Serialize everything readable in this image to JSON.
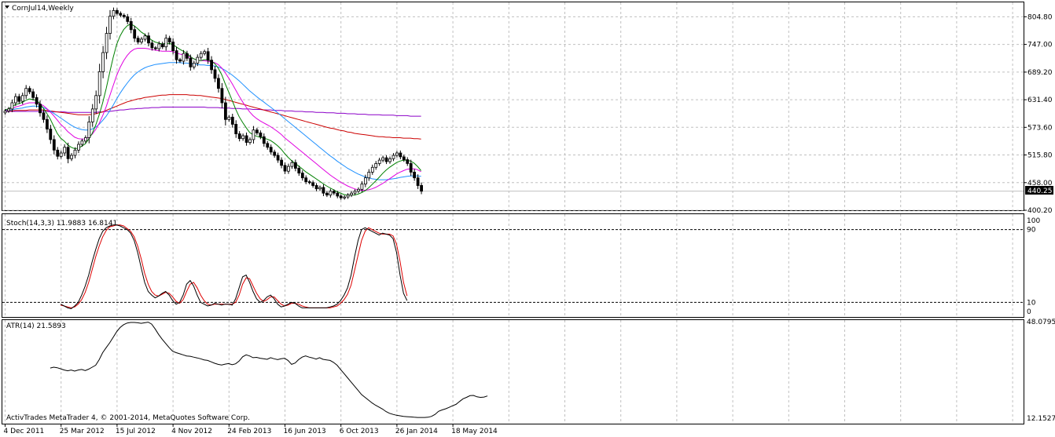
{
  "window": {
    "title": "CornJul14,Weekly",
    "copyright": "ActivTrades MetaTrader 4, © 2001-2014, MetaQuotes Software Corp."
  },
  "colors": {
    "grid": "#c0c0c0",
    "bull_candle": "#ffffff",
    "bear_candle": "#000000",
    "ma_fast": "#008000",
    "ma_magenta": "#e000e0",
    "ma_blue": "#1e90ff",
    "ma_red": "#cc0000",
    "ma_purple": "#8b00c8",
    "stoch_main": "#000000",
    "stoch_signal": "#dd0000",
    "atr": "#000000"
  },
  "chart_data": [
    {
      "type": "candlestick",
      "title": "CornJul14,Weekly",
      "ylim": [
        400.2,
        835.0
      ],
      "yticks": [
        804.8,
        747.0,
        689.2,
        631.4,
        573.6,
        515.8,
        458.0,
        400.2
      ],
      "ytick_labels": [
        "804.80",
        "747.00",
        "689.20",
        "631.40",
        "573.60",
        "515.80",
        "458.00",
        "400.20"
      ],
      "current_price_label": "440.25",
      "current_price": 440.25,
      "x_labels": [
        "4 Dec 2011",
        "25 Mar 2012",
        "15 Jul 2012",
        "4 Nov 2012",
        "24 Feb 2013",
        "16 Jun 2013",
        "6 Oct 2013",
        "26 Jan 2014",
        "18 May 2014"
      ],
      "close": [
        608,
        612,
        625,
        638,
        628,
        640,
        655,
        648,
        636,
        622,
        604,
        590,
        570,
        548,
        526,
        513,
        520,
        532,
        508,
        515,
        526,
        538,
        545,
        552,
        585,
        612,
        640,
        690,
        730,
        770,
        806,
        818,
        812,
        808,
        805,
        795,
        778,
        760,
        752,
        758,
        765,
        750,
        740,
        738,
        748,
        742,
        760,
        752,
        734,
        715,
        712,
        728,
        718,
        700,
        708,
        720,
        728,
        732,
        714,
        694,
        676,
        655,
        625,
        590,
        595,
        580,
        560,
        550,
        556,
        542,
        548,
        568,
        562,
        554,
        540,
        532,
        522,
        515,
        505,
        494,
        482,
        492,
        500,
        488,
        478,
        468,
        460,
        458,
        452,
        445,
        448,
        436,
        432,
        440,
        436,
        430,
        426,
        428,
        432,
        436,
        440,
        444,
        455,
        468,
        480,
        490,
        498,
        505,
        510,
        502,
        508,
        515,
        520,
        512,
        506,
        498,
        480,
        468,
        452,
        440
      ],
      "ma_fast": [
        610,
        612,
        616,
        621,
        623,
        626,
        630,
        633,
        632,
        630,
        624,
        614,
        603,
        591,
        576,
        561,
        551,
        545,
        537,
        532,
        529,
        530,
        534,
        539,
        549,
        561,
        578,
        600,
        625,
        655,
        688,
        720,
        747,
        765,
        778,
        786,
        790,
        786,
        780,
        773,
        768,
        762,
        756,
        752,
        750,
        748,
        749,
        749,
        747,
        742,
        737,
        733,
        729,
        722,
        717,
        714,
        713,
        715,
        715,
        712,
        707,
        698,
        684,
        665,
        648,
        630,
        612,
        596,
        584,
        573,
        563,
        558,
        555,
        553,
        551,
        549,
        546,
        541,
        535,
        528,
        519,
        511,
        504,
        498,
        493,
        487,
        481,
        476,
        471,
        466,
        461,
        456,
        451,
        447,
        443,
        439,
        436,
        433,
        432,
        432,
        432,
        434,
        437,
        441,
        447,
        454,
        461,
        469,
        477,
        484,
        490,
        495,
        500,
        503,
        505,
        505,
        503,
        499,
        492,
        483
      ],
      "ma_magenta": [
        609,
        611,
        613,
        616,
        618,
        620,
        623,
        625,
        625,
        625,
        623,
        619,
        613,
        606,
        598,
        589,
        580,
        573,
        565,
        559,
        553,
        550,
        549,
        549,
        553,
        559,
        569,
        582,
        598,
        617,
        639,
        661,
        682,
        699,
        713,
        724,
        732,
        737,
        739,
        739,
        739,
        738,
        736,
        735,
        734,
        733,
        733,
        733,
        732,
        730,
        727,
        725,
        723,
        720,
        717,
        714,
        713,
        713,
        712,
        711,
        709,
        705,
        698,
        688,
        677,
        665,
        652,
        639,
        627,
        616,
        606,
        598,
        592,
        587,
        583,
        579,
        575,
        570,
        565,
        559,
        552,
        546,
        540,
        534,
        528,
        522,
        516,
        510,
        504,
        498,
        492,
        486,
        480,
        474,
        469,
        464,
        459,
        455,
        451,
        448,
        445,
        443,
        442,
        442,
        443,
        445,
        448,
        452,
        456,
        461,
        466,
        471,
        476,
        480,
        483,
        486,
        487,
        487,
        485,
        481
      ],
      "ma_blue": [
        608,
        609,
        610,
        612,
        613,
        614,
        616,
        617,
        618,
        618,
        617,
        615,
        612,
        608,
        603,
        598,
        593,
        588,
        583,
        578,
        574,
        571,
        569,
        568,
        568,
        570,
        574,
        580,
        588,
        597,
        608,
        620,
        633,
        645,
        656,
        666,
        675,
        683,
        689,
        694,
        698,
        701,
        703,
        705,
        706,
        707,
        708,
        709,
        709,
        709,
        709,
        708,
        708,
        707,
        706,
        705,
        704,
        704,
        703,
        703,
        702,
        700,
        697,
        693,
        688,
        683,
        677,
        671,
        664,
        657,
        650,
        644,
        638,
        632,
        627,
        621,
        616,
        610,
        604,
        598,
        592,
        586,
        580,
        574,
        568,
        562,
        556,
        550,
        544,
        538,
        532,
        526,
        520,
        514,
        509,
        503,
        498,
        493,
        488,
        484,
        480,
        476,
        473,
        470,
        468,
        466,
        465,
        464,
        464,
        464,
        465,
        466,
        467,
        469,
        470,
        471,
        472,
        472,
        472,
        471
      ],
      "ma_red": [
        608,
        608,
        608,
        609,
        609,
        609,
        609,
        610,
        610,
        610,
        610,
        610,
        609,
        608,
        607,
        606,
        605,
        604,
        603,
        602,
        601,
        600,
        600,
        600,
        600,
        601,
        602,
        604,
        606,
        609,
        612,
        615,
        618,
        621,
        624,
        627,
        629,
        631,
        633,
        634,
        636,
        637,
        638,
        639,
        640,
        641,
        641,
        642,
        642,
        642,
        642,
        642,
        642,
        641,
        641,
        640,
        640,
        639,
        638,
        637,
        636,
        635,
        634,
        632,
        630,
        628,
        626,
        624,
        622,
        620,
        618,
        616,
        614,
        612,
        610,
        608,
        606,
        604,
        602,
        600,
        598,
        596,
        594,
        592,
        590,
        588,
        586,
        584,
        582,
        580,
        578,
        576,
        574,
        572,
        571,
        569,
        567,
        566,
        564,
        563,
        561,
        560,
        559,
        558,
        557,
        556,
        555,
        554,
        554,
        553,
        553,
        552,
        552,
        552,
        551,
        551,
        551,
        550,
        550,
        549
      ],
      "ma_purple": [
        607,
        607,
        607,
        607,
        607,
        607,
        607,
        607,
        607,
        607,
        607,
        607,
        607,
        606,
        606,
        606,
        606,
        606,
        605,
        605,
        605,
        605,
        605,
        605,
        605,
        605,
        605,
        606,
        606,
        607,
        607,
        608,
        609,
        610,
        610,
        611,
        612,
        612,
        613,
        613,
        614,
        614,
        615,
        615,
        615,
        616,
        616,
        616,
        616,
        616,
        616,
        616,
        616,
        616,
        616,
        616,
        616,
        616,
        615,
        615,
        615,
        615,
        614,
        614,
        614,
        613,
        613,
        613,
        612,
        612,
        612,
        611,
        611,
        611,
        610,
        610,
        610,
        609,
        609,
        609,
        608,
        608,
        608,
        607,
        607,
        607,
        606,
        606,
        606,
        605,
        605,
        605,
        604,
        604,
        604,
        603,
        603,
        603,
        602,
        602,
        602,
        601,
        601,
        601,
        600,
        600,
        600,
        600,
        599,
        599,
        599,
        599,
        598,
        598,
        598,
        598,
        597,
        597,
        597,
        597
      ]
    },
    {
      "type": "line",
      "title": "Stoch(14,3,3) 11.9883 16.8141",
      "ylim": [
        0,
        100
      ],
      "levels": [
        90,
        10
      ],
      "ytick_labels": [
        "100",
        "90",
        "10",
        "0"
      ],
      "start_index": 16,
      "series": [
        {
          "name": "main",
          "values": [
            8,
            6,
            4,
            3,
            6,
            10,
            18,
            28,
            40,
            55,
            68,
            80,
            88,
            92,
            94,
            95,
            95,
            94,
            92,
            90,
            86,
            78,
            65,
            48,
            32,
            22,
            18,
            15,
            17,
            20,
            22,
            18,
            12,
            8,
            10,
            18,
            30,
            34,
            28,
            18,
            10,
            8,
            6,
            7,
            9,
            8,
            7,
            8,
            8,
            7,
            14,
            26,
            38,
            40,
            32,
            22,
            14,
            10,
            12,
            16,
            18,
            14,
            8,
            5,
            6,
            8,
            10,
            9,
            6,
            4,
            4,
            4,
            4,
            4,
            4,
            4,
            4,
            5,
            6,
            8,
            12,
            18,
            26,
            40,
            60,
            78,
            90,
            92,
            90,
            88,
            86,
            84,
            86,
            85,
            84,
            80,
            65,
            40,
            20,
            12
          ]
        },
        {
          "name": "signal",
          "values": [
            7,
            6,
            5,
            4,
            5,
            8,
            13,
            21,
            32,
            46,
            60,
            72,
            82,
            89,
            93,
            94,
            95,
            95,
            94,
            91,
            88,
            82,
            72,
            58,
            42,
            30,
            22,
            18,
            17,
            19,
            21,
            20,
            16,
            11,
            9,
            13,
            22,
            30,
            32,
            26,
            18,
            12,
            8,
            7,
            8,
            8,
            8,
            8,
            8,
            8,
            10,
            18,
            30,
            37,
            36,
            28,
            20,
            14,
            11,
            13,
            16,
            16,
            12,
            8,
            6,
            7,
            9,
            9,
            8,
            6,
            5,
            4,
            4,
            4,
            4,
            4,
            4,
            4,
            5,
            6,
            9,
            13,
            19,
            29,
            45,
            62,
            78,
            88,
            92,
            90,
            88,
            86,
            85,
            85,
            85,
            83,
            74,
            55,
            32,
            17
          ]
        }
      ]
    },
    {
      "type": "line",
      "title": "ATR(14) 21.5893",
      "ylim": [
        12.1527,
        48.0795
      ],
      "ytick_labels": [
        "48.0795",
        "12.1527"
      ],
      "start_index": 13,
      "series": [
        {
          "name": "ATR(14)",
          "values": [
            31.5,
            31.8,
            31.6,
            31.2,
            30.8,
            30.5,
            30.8,
            30.4,
            30.8,
            31.0,
            30.6,
            31.1,
            31.8,
            32.5,
            34.5,
            37.0,
            38.8,
            40.5,
            42.5,
            44.5,
            46.0,
            47.0,
            47.6,
            47.8,
            47.8,
            47.7,
            47.5,
            47.7,
            47.9,
            47.2,
            45.5,
            43.5,
            41.8,
            40.3,
            38.8,
            37.5,
            37.0,
            36.6,
            36.2,
            35.8,
            35.7,
            35.4,
            35.1,
            34.8,
            34.4,
            34.2,
            33.7,
            33.2,
            32.8,
            32.6,
            32.9,
            33.1,
            32.7,
            33.0,
            34.0,
            35.5,
            36.2,
            35.8,
            35.2,
            35.3,
            35.0,
            34.8,
            34.6,
            35.2,
            34.8,
            34.5,
            34.8,
            35.0,
            34.2,
            32.8,
            33.3,
            34.5,
            35.4,
            35.8,
            35.4,
            35.1,
            34.7,
            35.2,
            34.6,
            34.4,
            34.2,
            33.5,
            32.5,
            31.0,
            29.5,
            28.0,
            26.5,
            25.0,
            23.5,
            22.0,
            21.0,
            20.0,
            19.0,
            18.2,
            17.5,
            16.8,
            15.9,
            15.3,
            14.9,
            14.6,
            14.4,
            14.2,
            14.1,
            14.0,
            13.9,
            13.8,
            13.8,
            13.8,
            13.9,
            14.2,
            14.9,
            16.0,
            16.5,
            16.9,
            17.4,
            18.0,
            18.5,
            19.5,
            20.5,
            21.0,
            21.6,
            21.7,
            21.2,
            21.0,
            21.1,
            21.5
          ]
        }
      ]
    }
  ]
}
